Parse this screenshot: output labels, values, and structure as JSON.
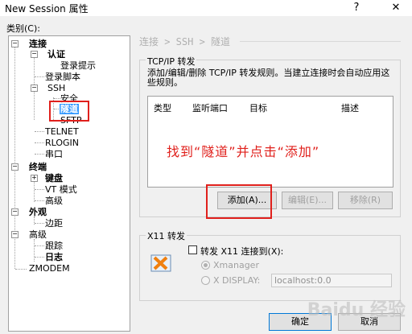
{
  "window": {
    "title": "New Session 属性",
    "help_button": "?",
    "close_button": "✕"
  },
  "category_label": "类别(C):",
  "tree": {
    "connection": "连接",
    "auth": "认证",
    "login_prompt": "登录提示",
    "login_script": "登录脚本",
    "ssh": "SSH",
    "security": "安全",
    "tunnel": "隧道",
    "sftp": "SFTP",
    "telnet": "TELNET",
    "rlogin": "RLOGIN",
    "serial": "串口",
    "terminal": "终端",
    "keyboard": "键盘",
    "vt_mode": "VT 模式",
    "advanced1": "高级",
    "appearance": "外观",
    "margin": "边距",
    "advanced2": "高级",
    "trace": "跟踪",
    "log": "日志",
    "zmodem": "ZMODEM"
  },
  "breadcrumb": "连接 > SSH > 隧道",
  "tcpip": {
    "title": "TCP/IP 转发",
    "description": "添加/编辑/删除 TCP/IP 转发规则。当建立连接时会自动应用这些规则。",
    "columns": [
      "类型",
      "监听端口",
      "目标",
      "描述"
    ],
    "add_button": "添加(A)...",
    "edit_button": "编辑(E)...",
    "remove_button": "移除(R)"
  },
  "annotation": "找到“隧道”并点击“添加”",
  "x11": {
    "title": "X11 转发",
    "checkbox_label": "转发 X11 连接到(X):",
    "option_xmanager": "Xmanager",
    "option_display": "X DISPLAY:",
    "display_value": "localhost:0.0"
  },
  "ok_button": "确定",
  "cancel_button": "取消",
  "watermark": "Baidu 经验"
}
